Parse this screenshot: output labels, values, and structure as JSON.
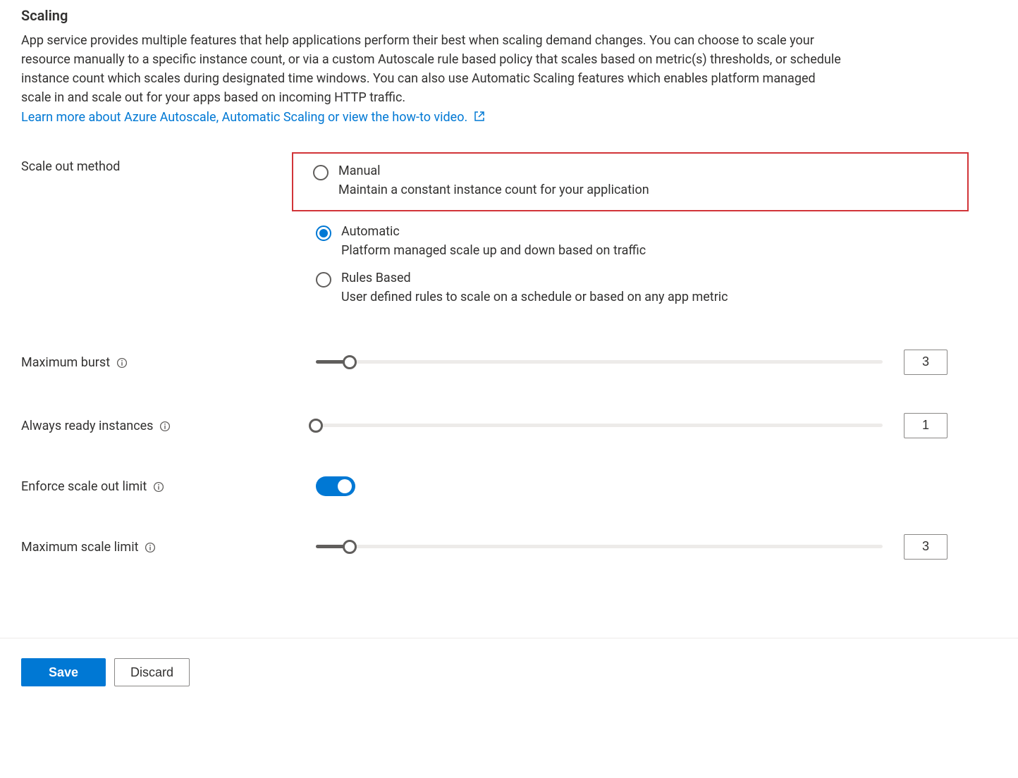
{
  "heading": "Scaling",
  "description": "App service provides multiple features that help applications perform their best when scaling demand changes. You can choose to scale your resource manually to a specific instance count, or via a custom Autoscale rule based policy that scales based on metric(s) thresholds, or schedule instance count which scales during designated time windows. You can also use Automatic Scaling features which enables platform managed scale in and scale out for your apps based on incoming HTTP traffic.",
  "learn_more_link": "Learn more about Azure Autoscale, Automatic Scaling or view the how-to video.",
  "scale_out_method": {
    "label": "Scale out method",
    "selected": "automatic",
    "options": {
      "manual": {
        "title": "Manual",
        "desc": "Maintain a constant instance count for your application"
      },
      "automatic": {
        "title": "Automatic",
        "desc": "Platform managed scale up and down based on traffic"
      },
      "rules": {
        "title": "Rules Based",
        "desc": "User defined rules to scale on a schedule or based on any app metric"
      }
    }
  },
  "maximum_burst": {
    "label": "Maximum burst",
    "value": "3",
    "percent": 6
  },
  "always_ready": {
    "label": "Always ready instances",
    "value": "1",
    "percent": 0
  },
  "enforce_limit": {
    "label": "Enforce scale out limit",
    "value": true
  },
  "max_scale_limit": {
    "label": "Maximum scale limit",
    "value": "3",
    "percent": 6
  },
  "footer": {
    "save": "Save",
    "discard": "Discard"
  }
}
